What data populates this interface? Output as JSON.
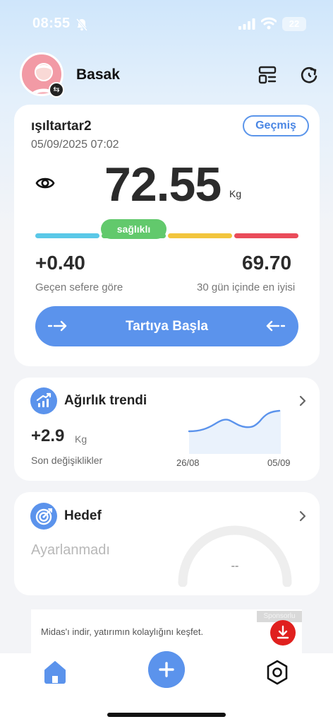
{
  "status_bar": {
    "time": "08:55",
    "battery": "22",
    "icons": [
      "bell-off-icon",
      "signal-icon",
      "wifi-icon",
      "battery-icon"
    ]
  },
  "header": {
    "user_name": "Basak",
    "icons": [
      "avatar",
      "switch-user-icon",
      "layout-icon",
      "sync-icon"
    ]
  },
  "weight_card": {
    "device_name": "ışıltartar2",
    "measure_time": "05/09/2025 07:02",
    "history_label": "Geçmiş",
    "weight": "72.55",
    "unit": "Kg",
    "status": "sağlıklı",
    "bmi_colors": [
      "#5ac8e8",
      "#62c96c",
      "#f2c53d",
      "#ea4c5a"
    ],
    "change_value": "+0.40",
    "change_label": "Geçen sefere göre",
    "best_value": "69.70",
    "best_label": "30 gün içinde en iyisi",
    "start_label": "Tartıya Başla"
  },
  "trend_card": {
    "title": "Ağırlık trendi",
    "value": "+2.9",
    "unit": "Kg",
    "label": "Son değişiklikler",
    "date_start": "26/08",
    "date_end": "05/09",
    "accent": "#5b93ec"
  },
  "goal_card": {
    "title": "Hedef",
    "status": "Ayarlanmadı",
    "gauge_value": "--"
  },
  "ad": {
    "sponsor": "Sponsorlu",
    "text": "Midas'ı indir, yatırımın kolaylığını keşfet."
  },
  "bottom_nav": {
    "tabs": [
      "home-icon",
      "add-icon",
      "settings-icon"
    ],
    "accent": "#5b93ec"
  }
}
